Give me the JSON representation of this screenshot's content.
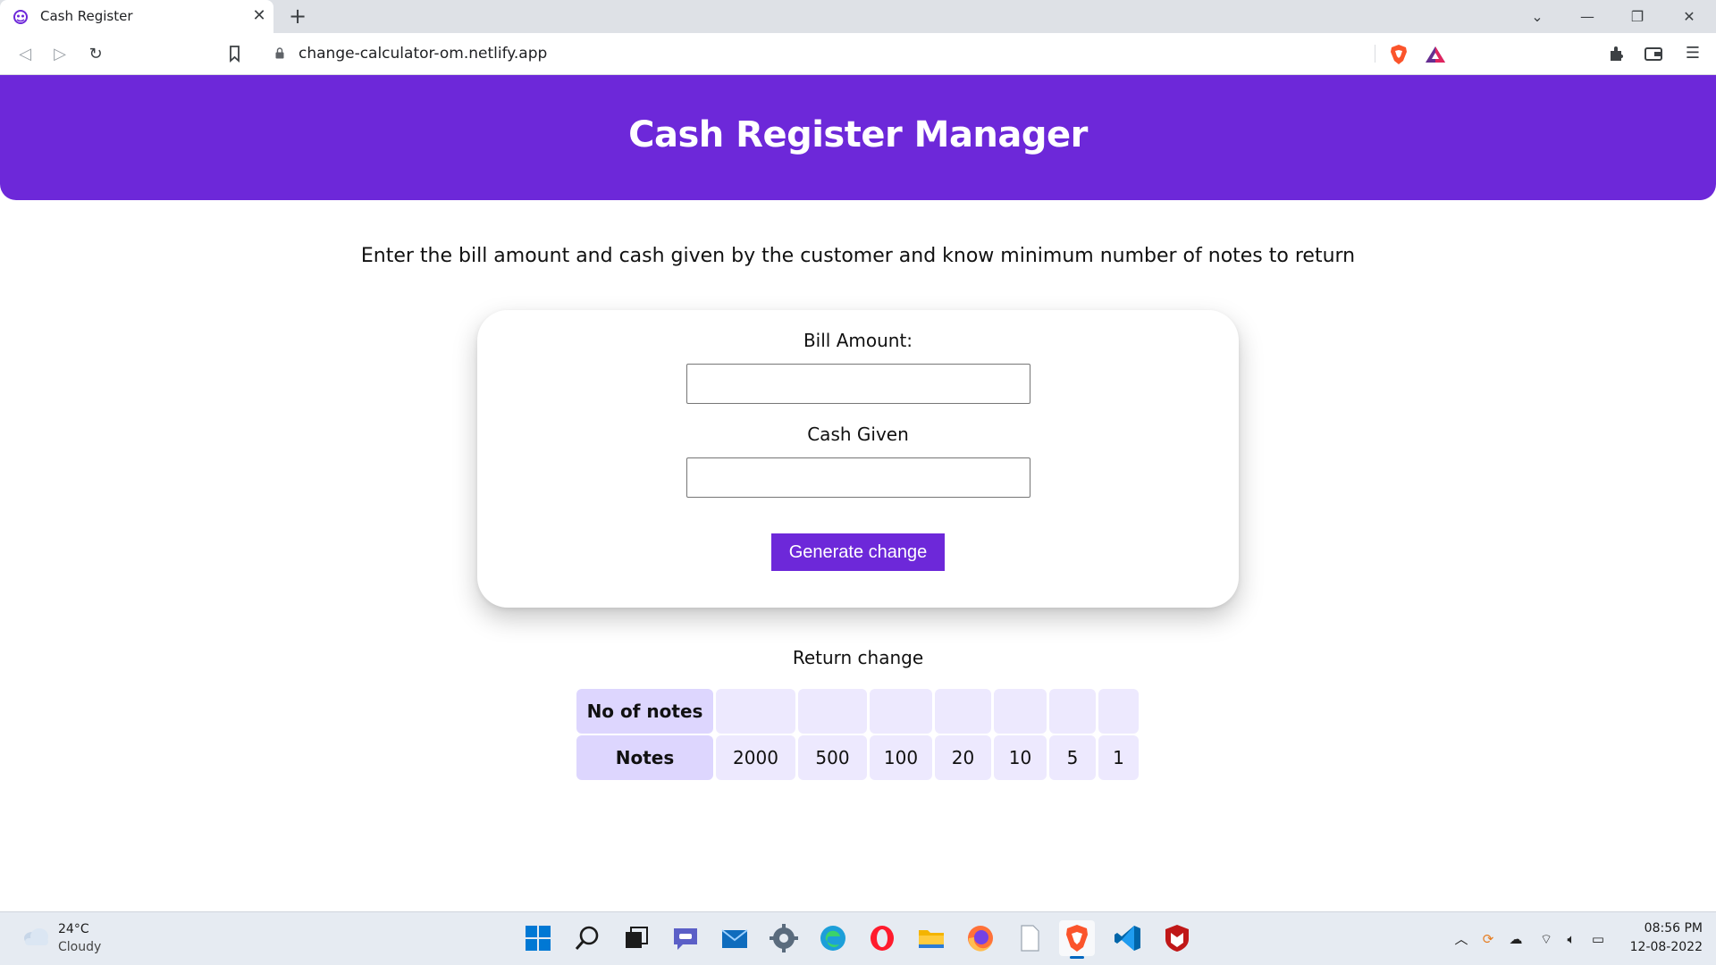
{
  "browser": {
    "tab_title": "Cash Register",
    "url": "change-calculator-om.netlify.app"
  },
  "page": {
    "title": "Cash Register Manager",
    "subtitle": "Enter the bill amount and cash given by the customer and know minimum number of notes to return",
    "bill_label": "Bill Amount:",
    "bill_value": "",
    "cash_label": "Cash Given",
    "cash_value": "",
    "generate_button": "Generate change",
    "return_label": "Return change",
    "accent_color": "#6d28d9"
  },
  "change_table": {
    "row1_header": "No of notes",
    "row2_header": "Notes",
    "notes": [
      "2000",
      "500",
      "100",
      "20",
      "10",
      "5",
      "1"
    ],
    "counts": [
      "",
      "",
      "",
      "",
      "",
      "",
      ""
    ]
  },
  "taskbar": {
    "temperature": "24°C",
    "condition": "Cloudy",
    "time": "08:56 PM",
    "date": "12-08-2022"
  }
}
